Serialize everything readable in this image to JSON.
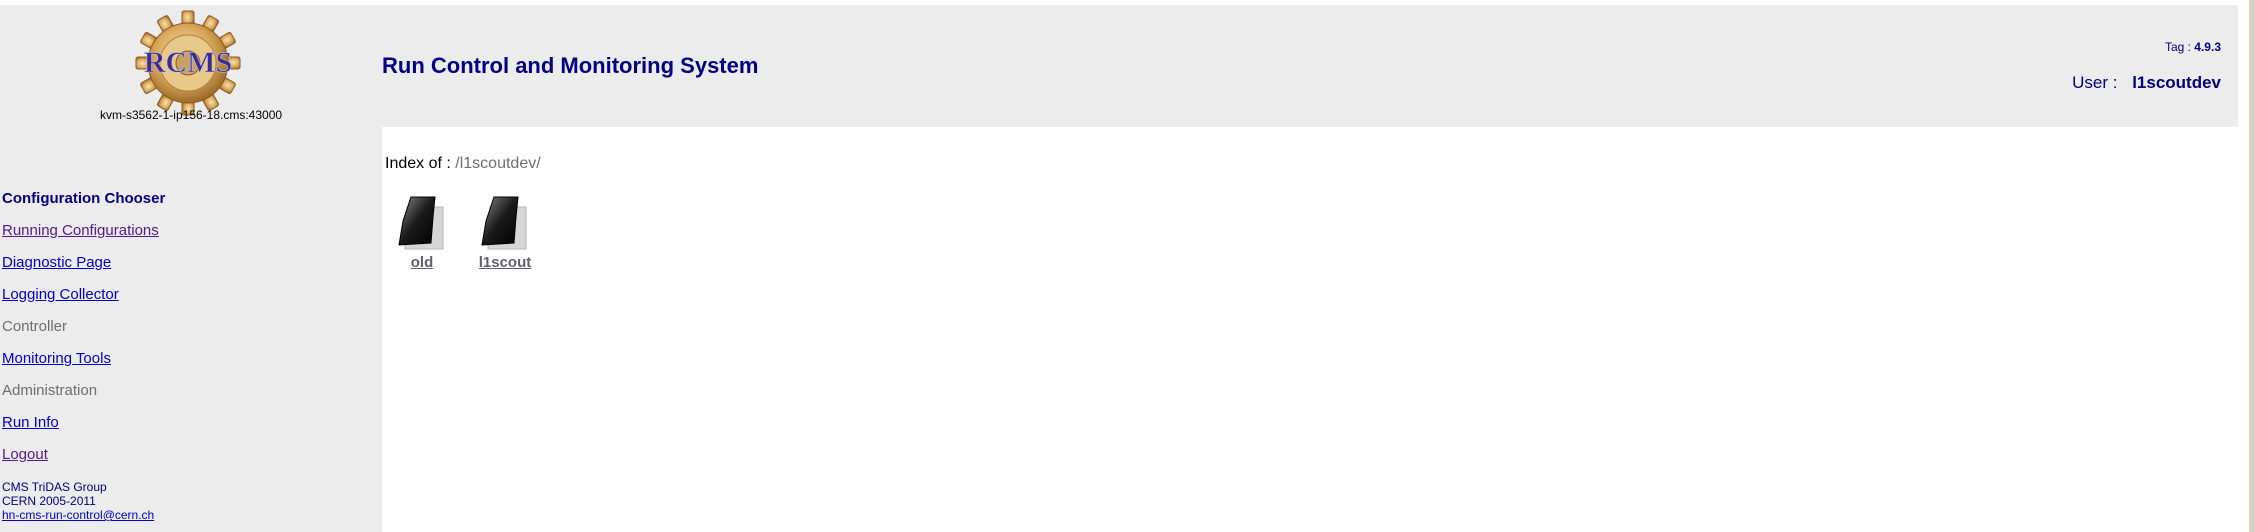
{
  "header": {
    "logo_text": "RCMS",
    "host": "kvm-s3562-1-ip156-18.cms:43000",
    "title": "Run Control and Monitoring System",
    "tag_label": "Tag :",
    "tag_value": "4.9.3",
    "user_label": "User :",
    "user_value": "l1scoutdev"
  },
  "sidebar": {
    "heading": "Configuration Chooser",
    "items": [
      {
        "label": "Running Configurations",
        "type": "link"
      },
      {
        "label": "Diagnostic Page",
        "type": "link"
      },
      {
        "label": "Logging Collector",
        "type": "link"
      },
      {
        "label": "Controller",
        "type": "static"
      },
      {
        "label": "Monitoring Tools",
        "type": "link"
      },
      {
        "label": "Administration",
        "type": "static"
      },
      {
        "label": "Run Info",
        "type": "link"
      },
      {
        "label": "Logout",
        "type": "link"
      }
    ],
    "footer": {
      "line1": "CMS TriDAS Group",
      "line2": "CERN 2005-2011",
      "email": "hn-cms-run-control@cern.ch"
    }
  },
  "main": {
    "index_label": "Index of :",
    "path": "/l1scoutdev/",
    "folders": [
      {
        "name": "old",
        "icon": "folder-icon"
      },
      {
        "name": "l1scout",
        "icon": "folder-icon"
      }
    ]
  },
  "colors": {
    "header_bg": "#ececec",
    "title": "#000080",
    "link": "#0000cc",
    "visited_link": "#551a8b",
    "static_text": "#6e6e6e"
  }
}
